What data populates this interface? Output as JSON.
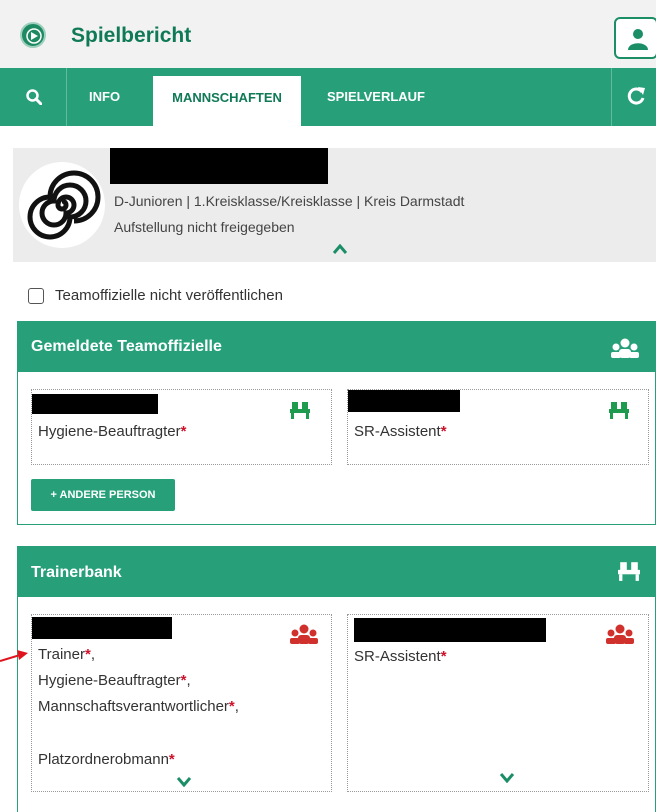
{
  "app": {
    "title": "Spielbericht"
  },
  "nav": {
    "tabs": [
      {
        "label": "INFO",
        "active": false
      },
      {
        "label": "MANNSCHAFTEN",
        "active": true
      },
      {
        "label": "SPIELVERLAUF",
        "active": false
      }
    ]
  },
  "team": {
    "league": "D-Junioren | 1.Kreisklasse/Kreisklasse | Kreis Darmstadt",
    "status": "Aufstellung nicht freigegeben"
  },
  "options": {
    "hide_officials_label": "Teamoffizielle nicht veröffentlichen",
    "hide_officials_checked": false
  },
  "officials_panel": {
    "title": "Gemeldete Teamoffizielle",
    "cards": [
      {
        "roles": [
          "Hygiene-Beauftragter"
        ]
      },
      {
        "roles": [
          "SR-Assistent"
        ]
      }
    ],
    "add_button": "+ ANDERE PERSON"
  },
  "bench_panel": {
    "title": "Trainerbank",
    "cards": [
      {
        "roles": [
          "Trainer",
          "Hygiene-Beauftragter",
          "Mannschaftsverantwortlicher",
          "Platzordnerobmann"
        ]
      },
      {
        "roles": [
          "SR-Assistent"
        ]
      }
    ]
  },
  "colors": {
    "primary": "#27a07a",
    "dark": "#0f7a55",
    "required": "#d0112b",
    "bench_icon_red": "#d0312d"
  }
}
